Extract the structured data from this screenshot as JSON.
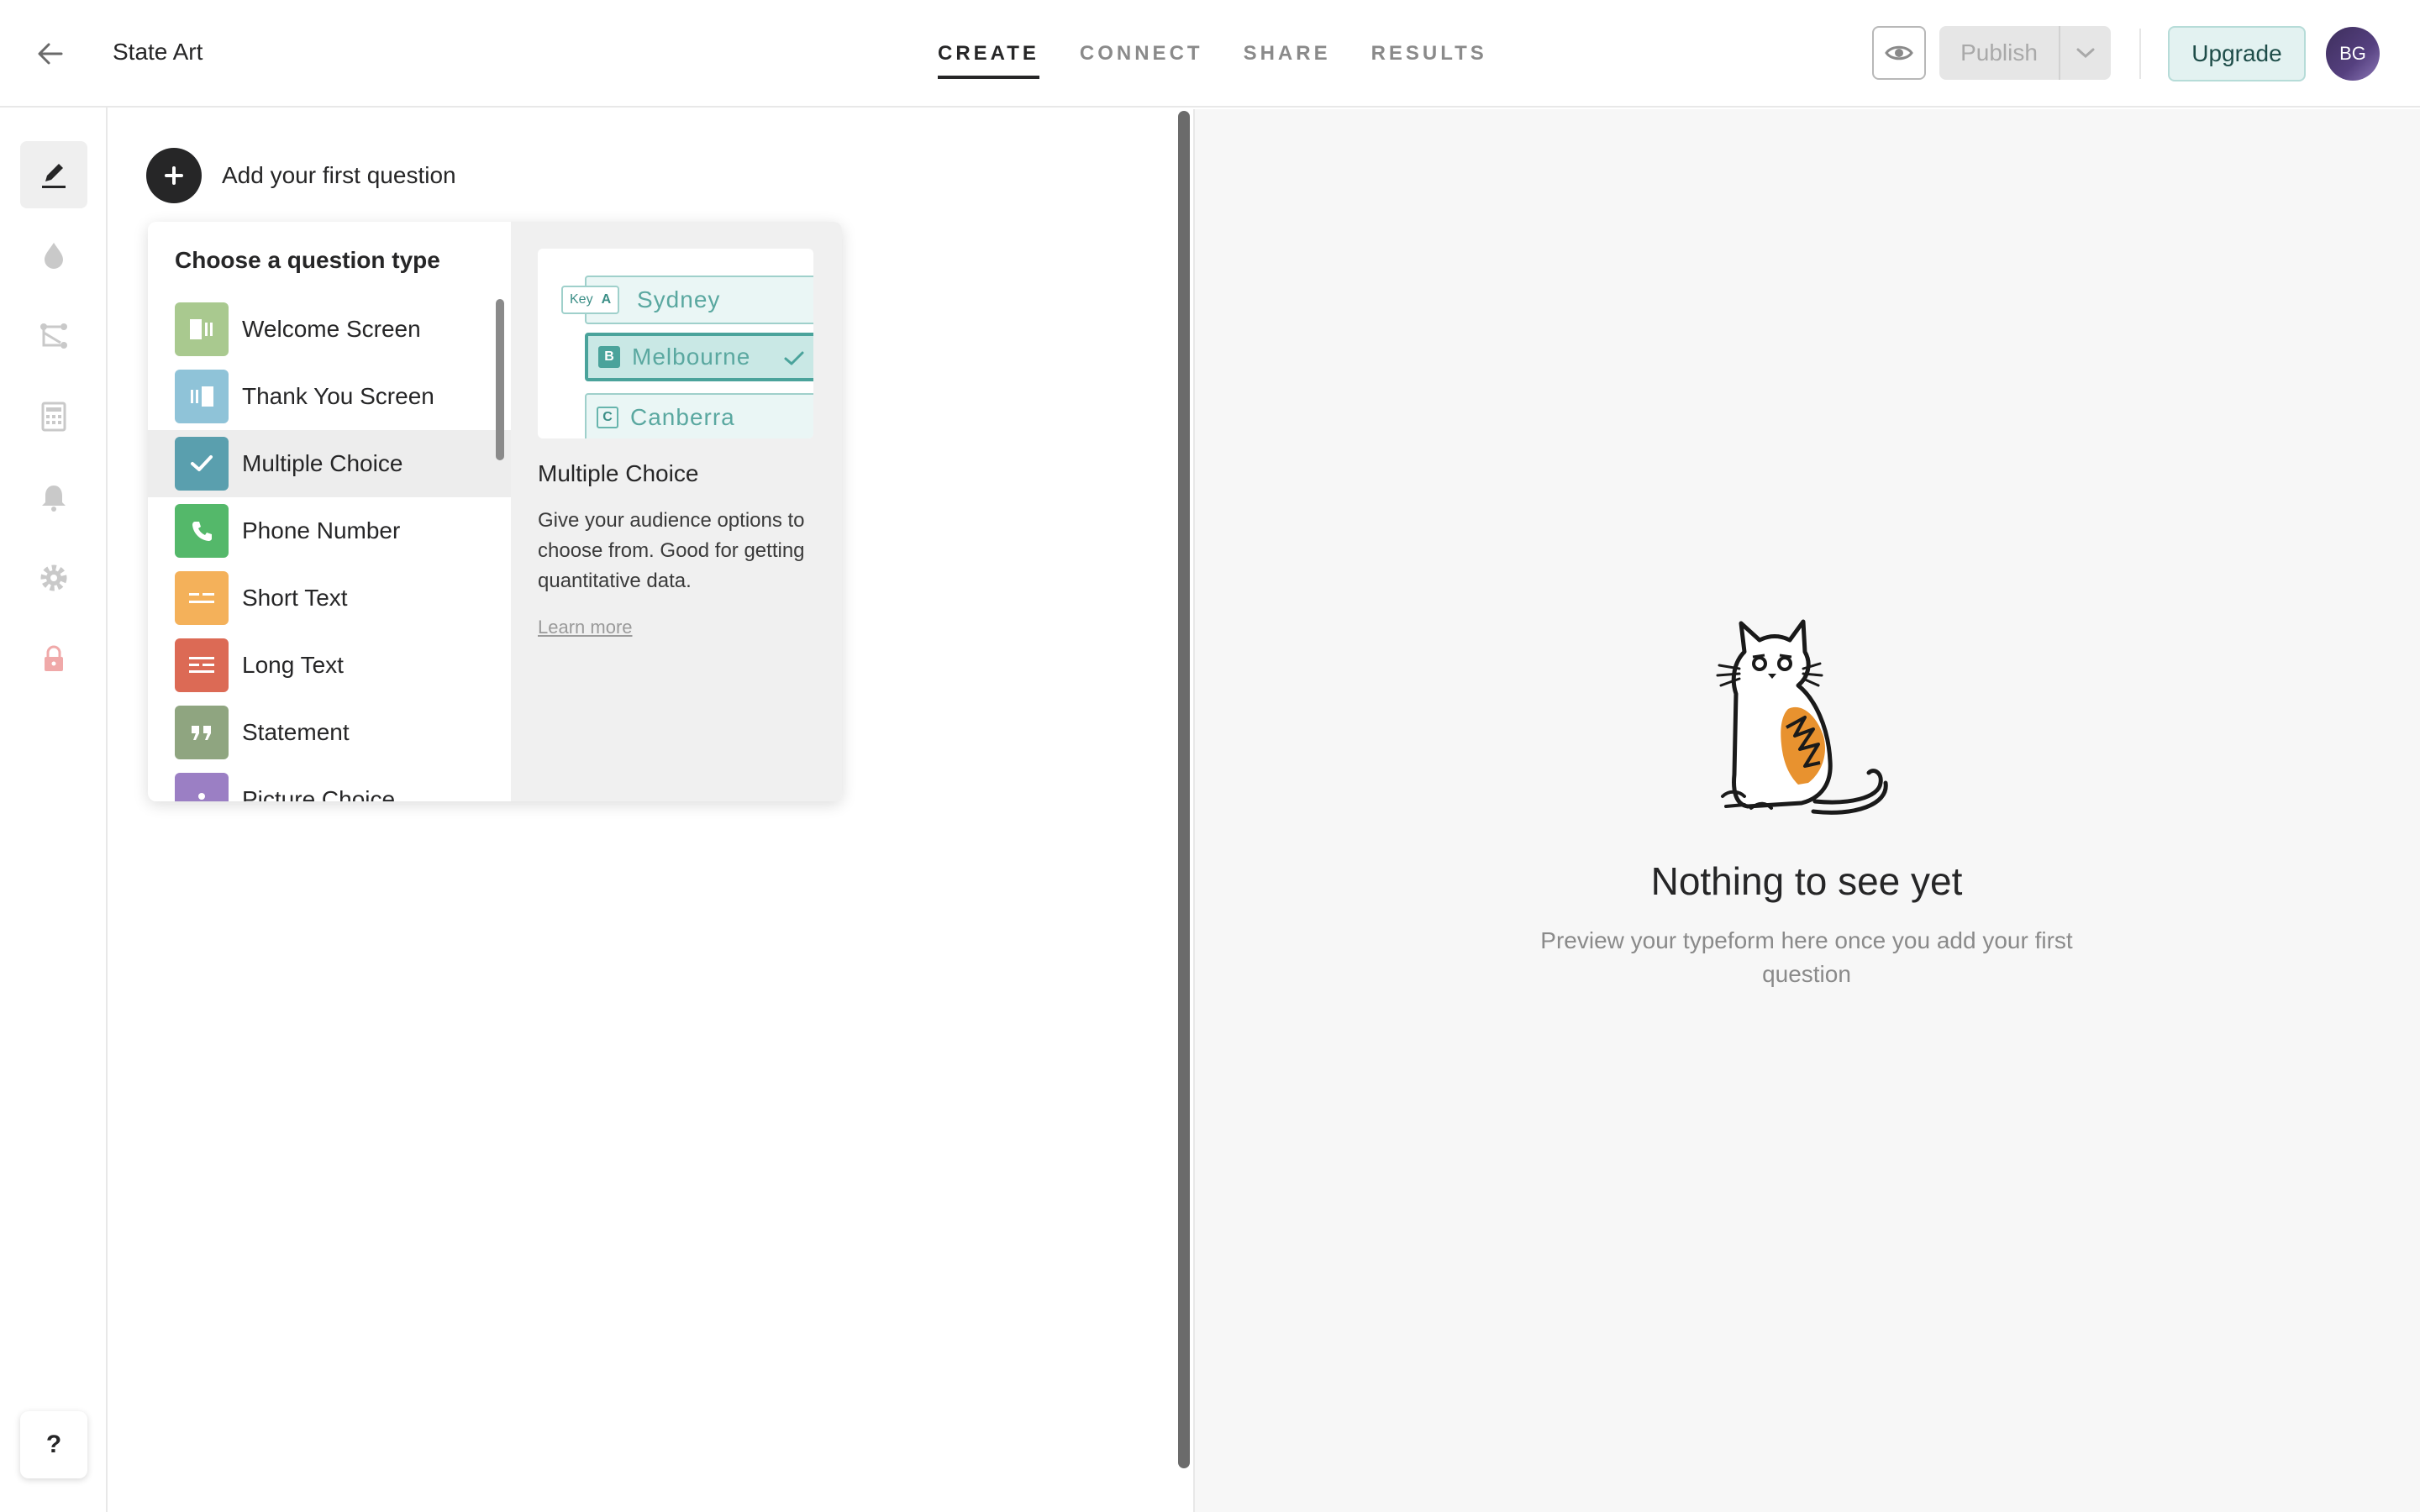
{
  "header": {
    "title": "State Art",
    "tabs": [
      {
        "label": "CREATE",
        "active": true
      },
      {
        "label": "CONNECT",
        "active": false
      },
      {
        "label": "SHARE",
        "active": false
      },
      {
        "label": "RESULTS",
        "active": false
      }
    ],
    "publish_label": "Publish",
    "upgrade_label": "Upgrade",
    "avatar_initials": "BG"
  },
  "rail": {
    "items": [
      "edit-icon",
      "theme-drop-icon",
      "logic-icon",
      "calculator-icon",
      "notification-bell-icon",
      "settings-gear-icon",
      "lock-icon"
    ],
    "help_label": "?"
  },
  "builder": {
    "add_question_label": "Add your first question",
    "question_types": {
      "heading": "Choose a question type",
      "items": [
        {
          "label": "Welcome Screen",
          "color": "#a9c98f",
          "icon": "welcome-screen-icon"
        },
        {
          "label": "Thank You Screen",
          "color": "#8fc3d8",
          "icon": "thank-you-screen-icon"
        },
        {
          "label": "Multiple Choice",
          "color": "#5a9fae",
          "icon": "check-icon"
        },
        {
          "label": "Phone Number",
          "color": "#54b86a",
          "icon": "phone-icon"
        },
        {
          "label": "Short Text",
          "color": "#f4b15a",
          "icon": "short-text-icon"
        },
        {
          "label": "Long Text",
          "color": "#dc6a55",
          "icon": "long-text-icon"
        },
        {
          "label": "Statement",
          "color": "#8fa580",
          "icon": "quote-icon"
        },
        {
          "label": "Picture Choice",
          "color": "#9b7fc4",
          "icon": "picture-icon"
        }
      ],
      "hovered": "Multiple Choice"
    },
    "detail": {
      "preview": {
        "key_hint": "Key",
        "choices": [
          {
            "key": "A",
            "label": "Sydney"
          },
          {
            "key": "B",
            "label": "Melbourne"
          },
          {
            "key": "C",
            "label": "Canberra"
          }
        ]
      },
      "title": "Multiple Choice",
      "description": "Give your audience options to choose from. Good for getting quantitative data.",
      "learn_more": "Learn more"
    }
  },
  "preview_panel": {
    "empty_title": "Nothing to see yet",
    "empty_subtitle": "Preview your typeform here once you add your first question"
  },
  "colors": {
    "accent_teal": "#4aa39b",
    "upgrade_bg": "#e3f2f1",
    "cat_orange": "#e8922f"
  }
}
